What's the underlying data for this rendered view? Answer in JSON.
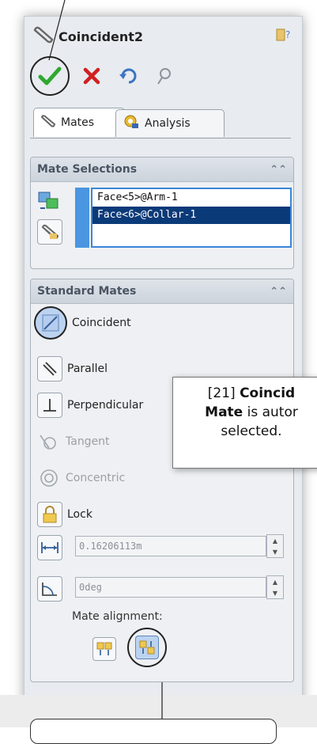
{
  "window": {
    "title": "Coincident2"
  },
  "tabs": [
    {
      "label": "Mates"
    },
    {
      "label": "Analysis"
    }
  ],
  "mate_selections": {
    "heading": "Mate Selections",
    "items": [
      {
        "label": "Face<5>@Arm-1",
        "selected": false
      },
      {
        "label": "Face<6>@Collar-1",
        "selected": true
      }
    ]
  },
  "standard_mates": {
    "heading": "Standard Mates",
    "items": [
      {
        "label": "Coincident",
        "enabled": true,
        "active": true
      },
      {
        "label": "Parallel",
        "enabled": true
      },
      {
        "label": "Perpendicular",
        "enabled": true
      },
      {
        "label": "Tangent",
        "enabled": false
      },
      {
        "label": "Concentric",
        "enabled": false
      },
      {
        "label": "Lock",
        "enabled": true
      }
    ],
    "distance_value": "0.16206113m",
    "angle_value": "0deg",
    "alignment_label": "Mate alignment:"
  },
  "callout": {
    "number": "[21]",
    "bold1": "Coincid",
    "bold2": "Mate",
    "line2": " is autor",
    "line3": "selected."
  },
  "colors": {
    "accent": "#3b86d8",
    "selection": "#0b3a78",
    "ok": "#2fa82f",
    "cancel": "#d11f1f"
  }
}
